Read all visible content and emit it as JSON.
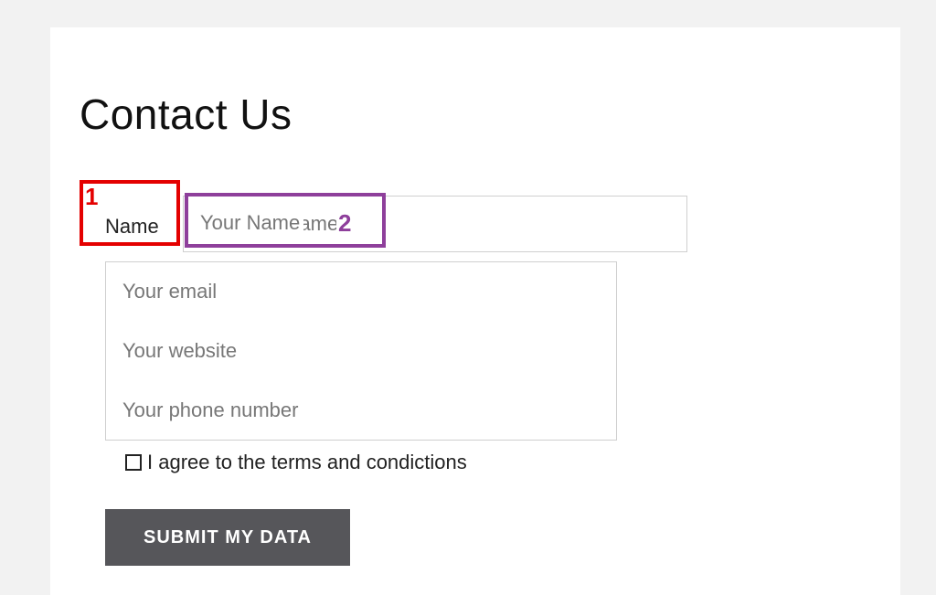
{
  "title": "Contact Us",
  "annotations": {
    "red_number": "1",
    "purple_number": "2"
  },
  "fields": {
    "name": {
      "label": "Name",
      "placeholder": "Your Name"
    },
    "email": {
      "placeholder": "Your email"
    },
    "website": {
      "placeholder": "Your website"
    },
    "phone": {
      "placeholder": "Your phone number"
    }
  },
  "agree_label": "I agree to the terms and condictions",
  "submit_label": "SUBMIT MY DATA"
}
